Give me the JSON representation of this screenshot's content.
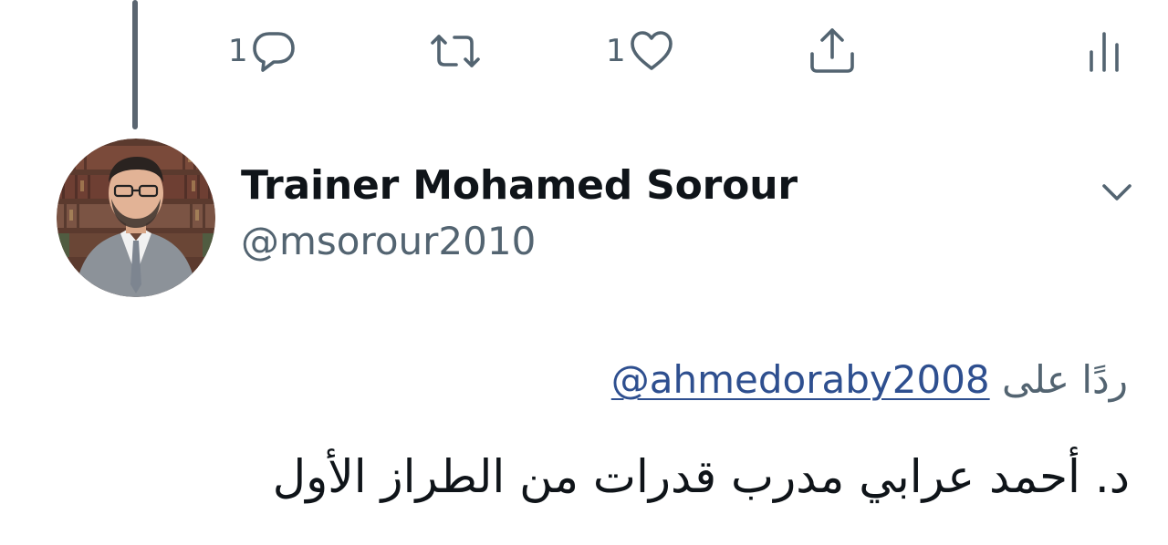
{
  "actions": {
    "reply_count": "1",
    "retweet_count": "",
    "like_count": "1"
  },
  "author": {
    "display_name": "Trainer Mohamed Sorour",
    "handle": "@msorour2010"
  },
  "reply_to": {
    "prefix": "ردًا على",
    "mention": "@ahmedoraby2008"
  },
  "tweet": {
    "text": "د. أحمد عرابي مدرب قدرات من الطراز الأول"
  },
  "icons": [
    "reply-icon",
    "retweet-icon",
    "like-icon",
    "share-icon",
    "analytics-icon",
    "chevron-down-icon"
  ],
  "colors": {
    "text": "#0f1419",
    "secondary": "#536471",
    "link": "#2e4f8f",
    "thread_line": "#5a6570"
  }
}
